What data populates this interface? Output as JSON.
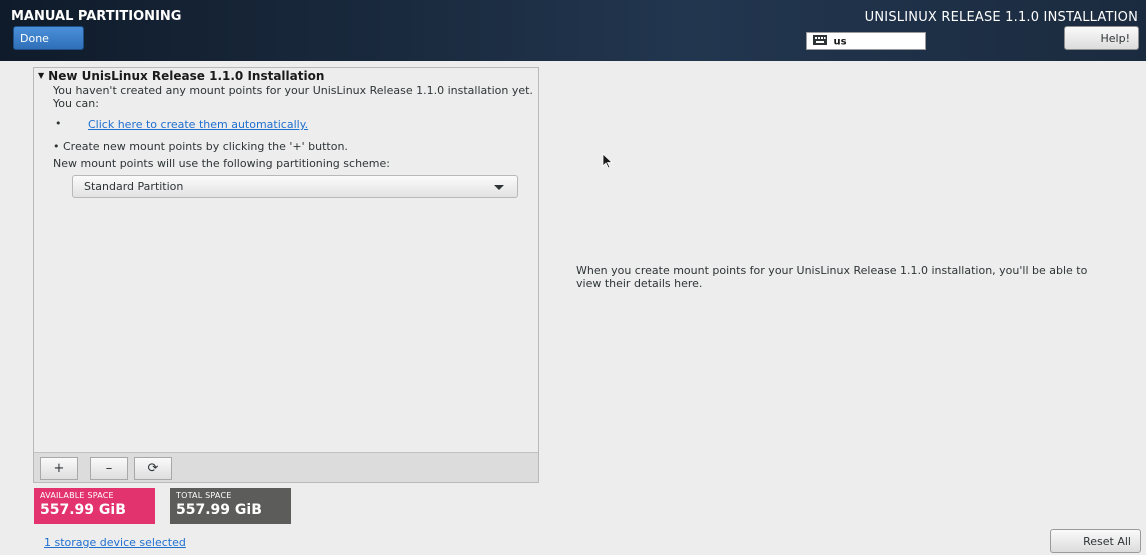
{
  "header": {
    "title": "MANUAL PARTITIONING",
    "done_label": "Done",
    "install_title": "UNISLINUX RELEASE 1.1.0 INSTALLATION",
    "keyboard_layout": "us",
    "help_label": "Help!",
    "colors": {
      "done_button": "#2f6fb8"
    }
  },
  "left_panel": {
    "section_title": "New UnisLinux Release 1.1.0 Installation",
    "intro_text": "You haven't created any mount points for your UnisLinux Release 1.1.0 installation yet.  You can:",
    "auto_create_link": "Click here to create them automatically.",
    "manual_hint": "Create new mount points by clicking the '+' button.",
    "scheme_text": "New mount points will use the following partitioning scheme:",
    "scheme_selected": "Standard Partition",
    "toolbar": {
      "add_label": "+",
      "remove_label": "–",
      "refresh_label": "⟳"
    }
  },
  "space": {
    "available_label": "AVAILABLE SPACE",
    "available_value": "557.99 GiB",
    "total_label": "TOTAL SPACE",
    "total_value": "557.99 GiB",
    "colors": {
      "available": "#e2336e",
      "total": "#5c5c5a"
    }
  },
  "storage_link": "1 storage device selected",
  "right_info": "When you create mount points for your UnisLinux Release 1.1.0 installation, you'll be able to view their details here.",
  "reset_label": "Reset All",
  "icons": {
    "keyboard": "keyboard-icon",
    "expander": "triangle-down-icon",
    "dropdown": "chevron-down-icon",
    "cursor": "mouse-pointer-icon"
  }
}
